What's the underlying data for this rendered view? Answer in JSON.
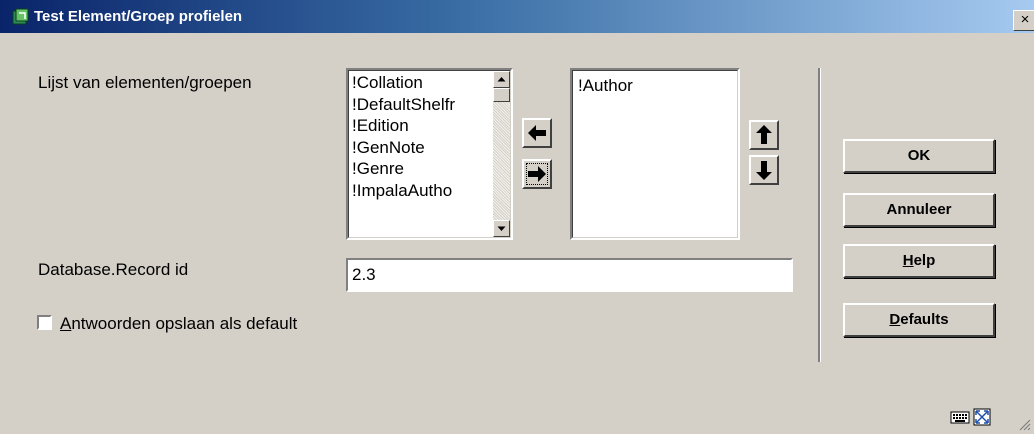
{
  "window": {
    "title": "Test Element/Groep profielen",
    "close_label": "×"
  },
  "form": {
    "list_label": "Lijst van elementen/groepen",
    "available_items": [
      "!Collation",
      "!DefaultShelfr",
      "!Edition",
      "!GenNote",
      "!Genre",
      "!ImpalaAutho"
    ],
    "selected_items": [
      "!Author"
    ],
    "record_id_label": "Database.Record id",
    "record_id_value": "2.3",
    "checkbox_label_accel": "A",
    "checkbox_label_rest": "ntwoorden opslaan als default",
    "checkbox_checked": false
  },
  "buttons": {
    "ok": "OK",
    "cancel": "Annuleer",
    "help_accel": "H",
    "help_rest": "elp",
    "defaults_accel": "D",
    "defaults_rest": "efaults"
  },
  "icons": {
    "app": "app-icon",
    "move_left": "arrow-left-icon",
    "move_right": "arrow-right-icon",
    "move_up": "arrow-up-icon",
    "move_down": "arrow-down-icon",
    "keyboard": "keyboard-icon",
    "resize": "resize-icon"
  }
}
